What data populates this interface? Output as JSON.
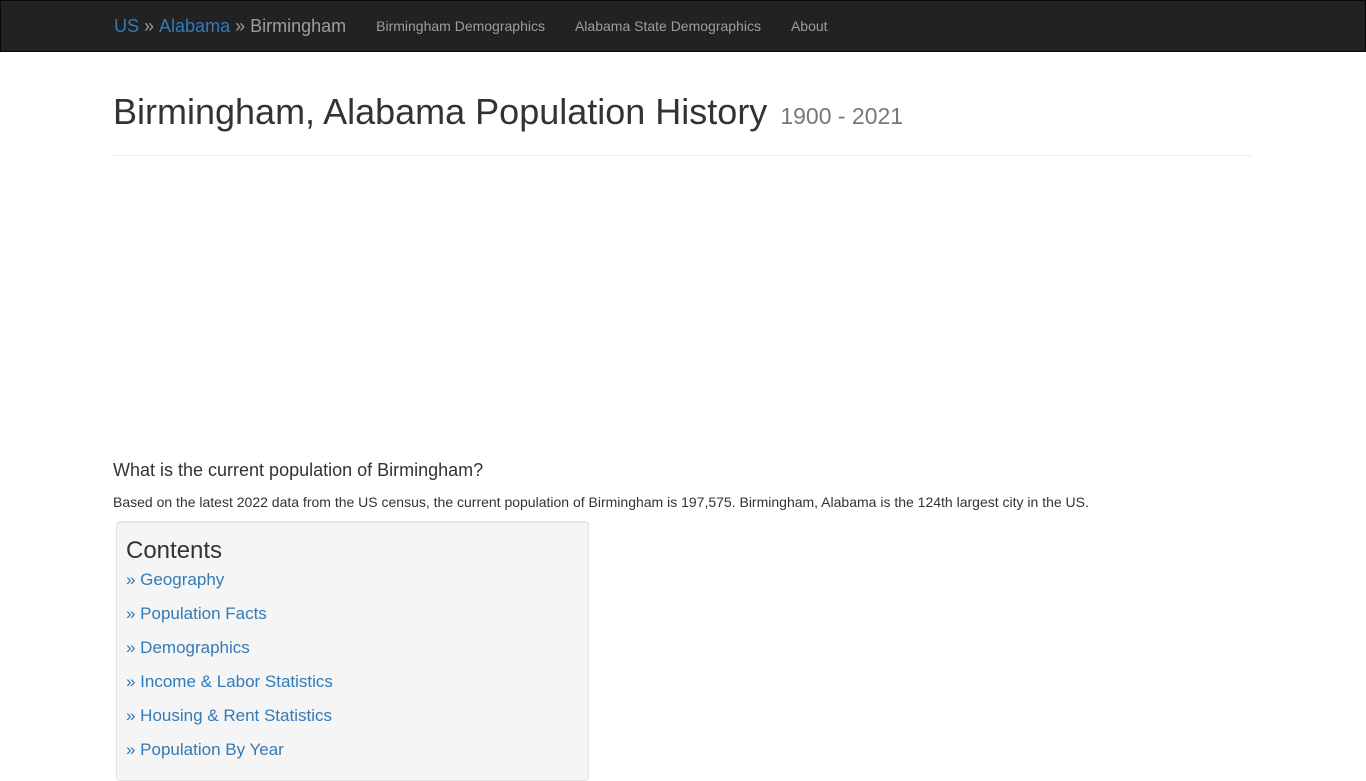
{
  "navbar": {
    "breadcrumb": [
      {
        "label": "US",
        "link": true
      },
      {
        "label": "Alabama",
        "link": true
      },
      {
        "label": "Birmingham",
        "link": false
      }
    ],
    "separator": "»",
    "links": [
      {
        "label": "Birmingham Demographics"
      },
      {
        "label": "Alabama State Demographics"
      },
      {
        "label": "About"
      }
    ]
  },
  "header": {
    "title": "Birmingham, Alabama Population History",
    "subtitle": "1900 - 2021"
  },
  "intro": {
    "question": "What is the current population of Birmingham?",
    "answer": "Based on the latest 2022 data from the US census, the current population of Birmingham is 197,575. Birmingham, Alabama is the 124th largest city in the US."
  },
  "contents": {
    "title": "Contents",
    "items": [
      {
        "label": "» Geography"
      },
      {
        "label": "» Population Facts"
      },
      {
        "label": "» Demographics"
      },
      {
        "label": "» Income & Labor Statistics"
      },
      {
        "label": "» Housing & Rent Statistics"
      },
      {
        "label": "» Population By Year"
      }
    ]
  },
  "colors": {
    "navbar_bg": "#222222",
    "link": "#337ab7",
    "nav_text": "#9d9d9d",
    "well_bg": "#f5f5f5"
  }
}
